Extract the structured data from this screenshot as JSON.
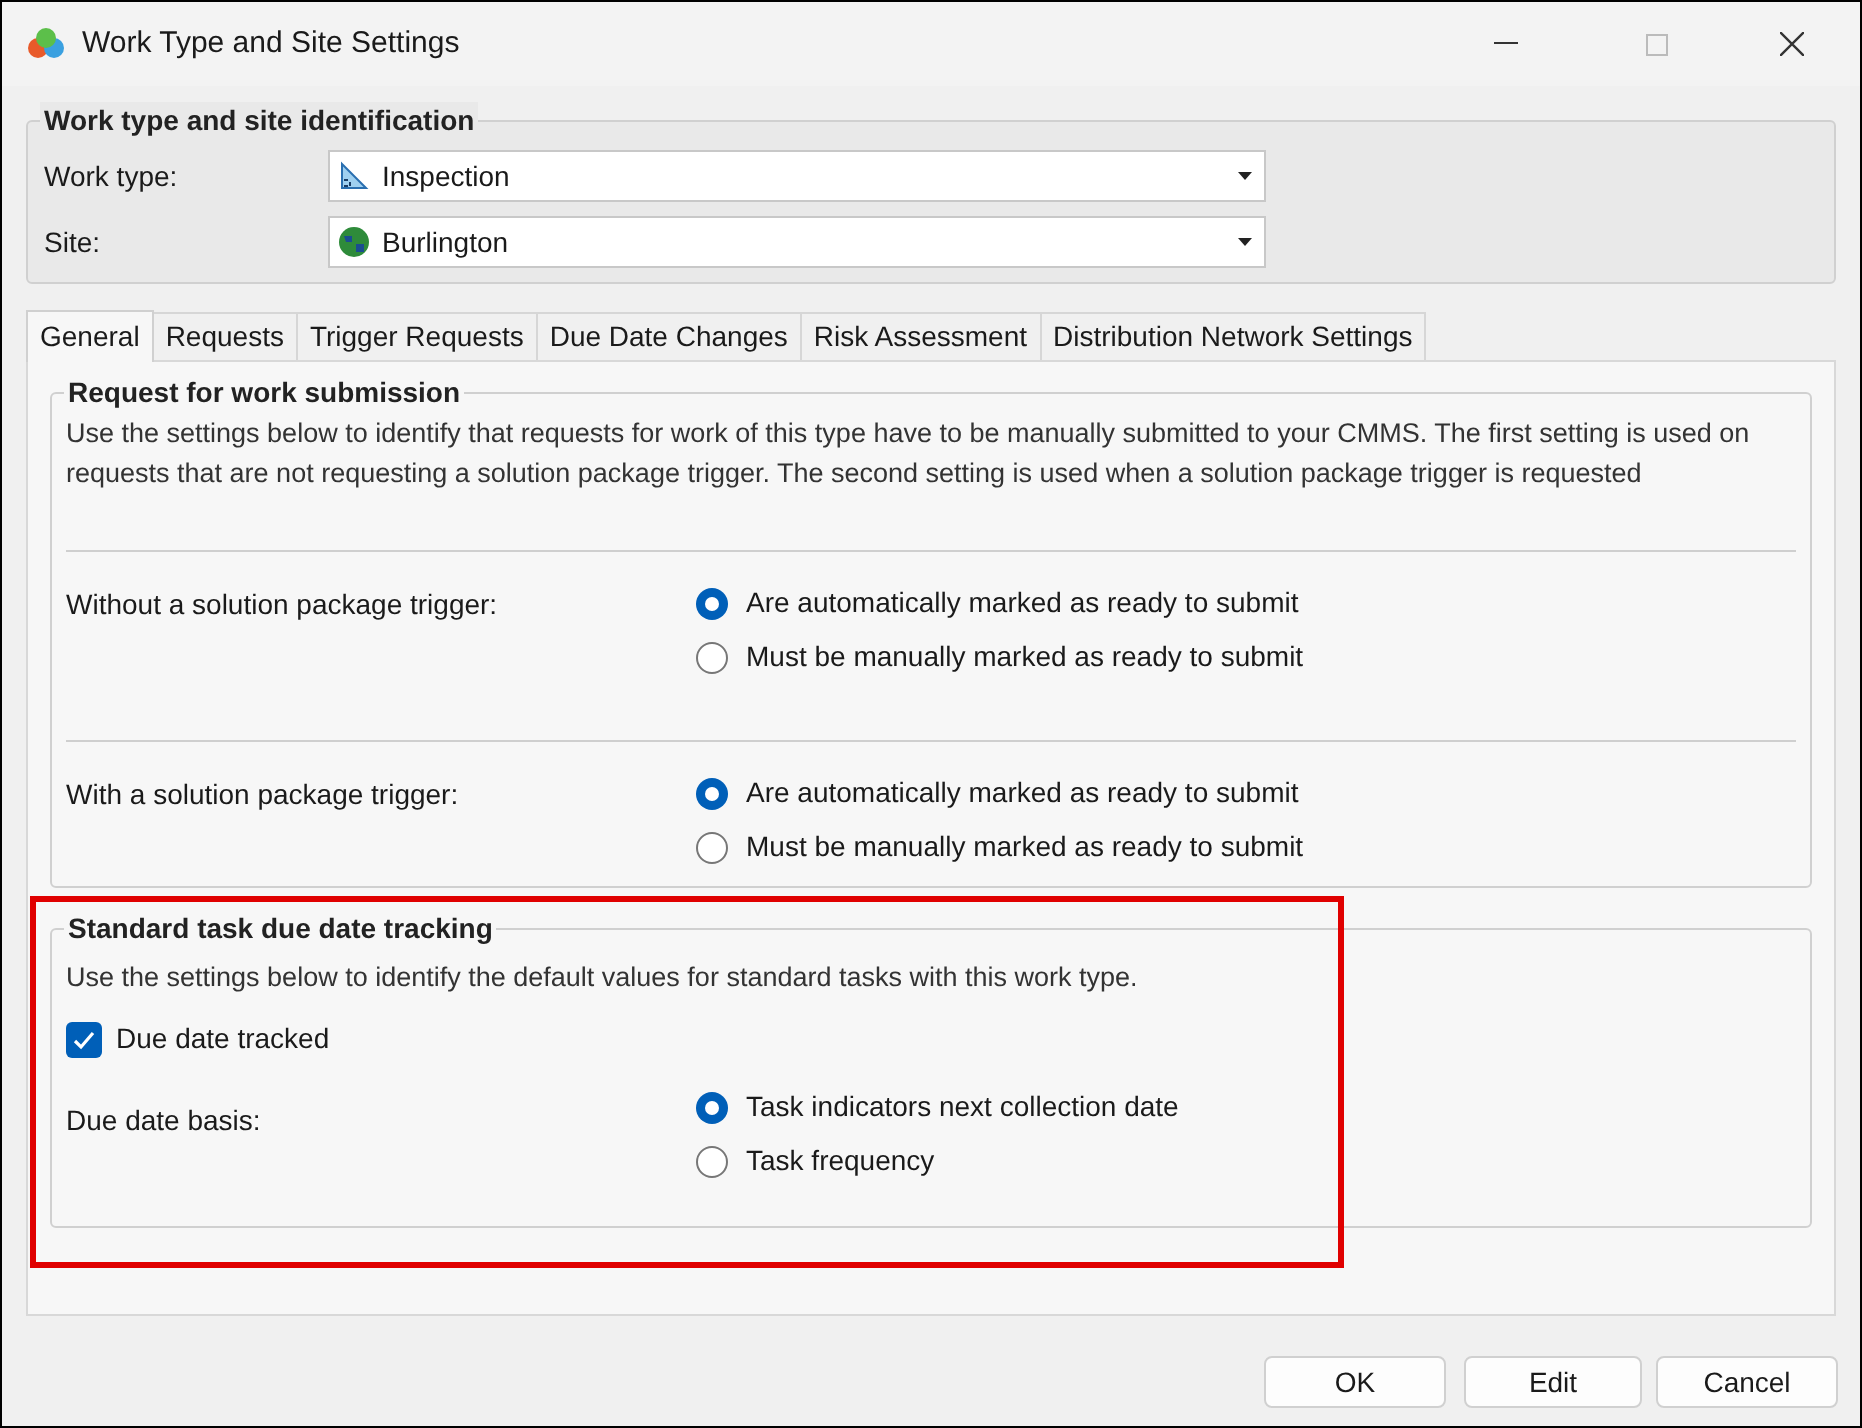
{
  "window": {
    "title": "Work Type and Site Settings"
  },
  "identification": {
    "title": "Work type and site identification",
    "fields": [
      {
        "label": "Work type:",
        "value": "Inspection",
        "kind": "worktype"
      },
      {
        "label": "Site:",
        "value": "Burlington",
        "kind": "site"
      }
    ]
  },
  "tabs": [
    {
      "label": "General",
      "selected": true
    },
    {
      "label": "Requests",
      "selected": false
    },
    {
      "label": "Trigger Requests",
      "selected": false
    },
    {
      "label": "Due Date Changes",
      "selected": false
    },
    {
      "label": "Risk Assessment",
      "selected": false
    },
    {
      "label": "Distribution Network Settings",
      "selected": false
    }
  ],
  "submission": {
    "title": "Request for work submission",
    "description": "Use the settings below to identify that requests for work of this type have to be manually submitted to your CMMS.  The first setting is used on requests that are not requesting a solution package trigger.   The second setting is used when a solution package trigger is requested",
    "groups": [
      {
        "label": "Without a solution package trigger:",
        "options": [
          {
            "label": "Are automatically marked as ready to submit",
            "selected": true
          },
          {
            "label": "Must be manually marked as ready to submit",
            "selected": false
          }
        ]
      },
      {
        "label": "With a solution package trigger:",
        "options": [
          {
            "label": "Are automatically marked as ready to submit",
            "selected": true
          },
          {
            "label": "Must be manually marked as ready to submit",
            "selected": false
          }
        ]
      }
    ]
  },
  "tracking": {
    "title": "Standard task due date tracking",
    "description": "Use the settings below to identify the default values for standard tasks with this work type.",
    "checkbox": {
      "label": "Due date tracked",
      "checked": true
    },
    "basis": {
      "label": "Due date basis:",
      "options": [
        {
          "label": "Task indicators next collection date",
          "selected": true
        },
        {
          "label": "Task frequency",
          "selected": false
        }
      ]
    }
  },
  "buttons": [
    "OK",
    "Edit",
    "Cancel"
  ]
}
